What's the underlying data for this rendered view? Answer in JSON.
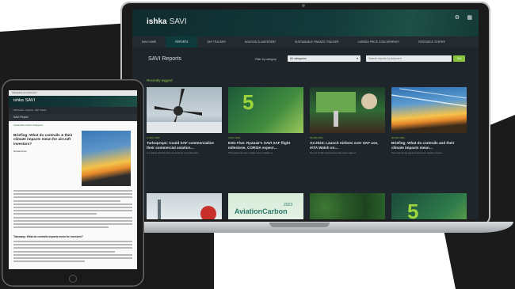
{
  "laptop": {
    "brand": "ishka",
    "brand_suffix": "SAVI",
    "nav": [
      "SAVI HOME",
      "REPORTS",
      "SAF TRACKER",
      "AVIATION CLIMATEDEBT",
      "SUSTAINABLE FINANCE TRACKER",
      "CARBON PRICE CONCURRENCY",
      "RESOURCE CENTRE"
    ],
    "active_nav_index": 1,
    "page_title": "SAVI Reports",
    "filter_label": "Filter by category",
    "category_value": "All categories",
    "search_placeholder": "Search reports by keyword",
    "search_button": "Go",
    "section_title": "Recently tagged",
    "cards": [
      {
        "date": "11 MAY 2023",
        "title": "Turboprops: Could SAF commercialise their commercial aviation…",
        "excerpt": "In a market still fresh from new products in a problematic..."
      },
      {
        "date": "4 MAY 2023",
        "title": "ESG Five: Ryanair's SAVI SAF flight milestone, CORSIA expect…",
        "excerpt": "This quarter has seen notable news in relation to..."
      },
      {
        "date": "28 APR 2023",
        "title": "A4 2023: Launch Airlines over SAF use, IATA Walsh on…",
        "excerpt": "The rise of SAF commitments took centre stage at..."
      },
      {
        "date": "20 APR 2023",
        "title": "Briefing: What do contrails and their climate impacts mean…",
        "excerpt": "There are two big questions the sector needs to answer..."
      },
      {
        "date": "",
        "title": "",
        "excerpt": ""
      },
      {
        "date": "",
        "title": "",
        "excerpt": ""
      },
      {
        "date": "",
        "title": "",
        "excerpt": ""
      },
      {
        "date": "",
        "title": "",
        "excerpt": ""
      }
    ],
    "card_badge_5": "5",
    "card_badge_8": "5",
    "aviation_carbon_text": "AviationCarbon",
    "aviation_carbon_year": "2023"
  },
  "tablet": {
    "url_bar": "ishkaglobal.com/savi/report",
    "brand": "ishka",
    "brand_suffix": "SAVI",
    "nav_text": "SAVI Home  ·  Reports  ·  SAF Tracker",
    "sub_title": "SAVI Report",
    "crumb": "Sustainable Aviation Intelligence",
    "article_title": "Briefing: What do contrails & their climate impacts mean for aircraft investors?",
    "author": "Michael Doran",
    "question": "Takeaway: What do contrails impacts mean for investors?"
  },
  "colors": {
    "accent": "#8ac43f",
    "header": "#0f2b2e",
    "body_bg": "#1f262b"
  }
}
